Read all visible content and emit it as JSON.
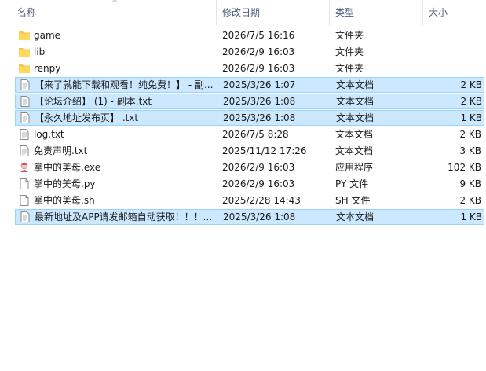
{
  "columns": {
    "name": "名称",
    "date": "修改日期",
    "type": "类型",
    "size": "大小"
  },
  "sort_indicator": "^",
  "files": [
    {
      "name": "game",
      "date": "2026/7/5 16:16",
      "type": "文件夹",
      "size": "",
      "icon": "folder-icon",
      "selected": false
    },
    {
      "name": "lib",
      "date": "2026/2/9 16:03",
      "type": "文件夹",
      "size": "",
      "icon": "folder-icon",
      "selected": false
    },
    {
      "name": "renpy",
      "date": "2026/2/9 16:03",
      "type": "文件夹",
      "size": "",
      "icon": "folder-icon",
      "selected": false
    },
    {
      "name": "【来了就能下载和观看！纯免费！】 - 副...",
      "date": "2025/3/26 1:07",
      "type": "文本文档",
      "size": "2 KB",
      "icon": "text-file-icon",
      "selected": true
    },
    {
      "name": "【论坛介绍】 (1) - 副本.txt",
      "date": "2025/3/26 1:08",
      "type": "文本文档",
      "size": "2 KB",
      "icon": "text-file-icon",
      "selected": true
    },
    {
      "name": "【永久地址发布页】 .txt",
      "date": "2025/3/26 1:08",
      "type": "文本文档",
      "size": "1 KB",
      "icon": "text-file-icon",
      "selected": true
    },
    {
      "name": "log.txt",
      "date": "2026/7/5 8:28",
      "type": "文本文档",
      "size": "2 KB",
      "icon": "text-file-icon",
      "selected": false
    },
    {
      "name": "免责声明.txt",
      "date": "2025/11/12 17:26",
      "type": "文本文档",
      "size": "3 KB",
      "icon": "text-file-icon",
      "selected": false
    },
    {
      "name": "掌中的美母.exe",
      "date": "2026/2/9 16:03",
      "type": "应用程序",
      "size": "102 KB",
      "icon": "app-icon",
      "selected": false
    },
    {
      "name": "掌中的美母.py",
      "date": "2026/2/9 16:03",
      "type": "PY 文件",
      "size": "9 KB",
      "icon": "blank-file-icon",
      "selected": false
    },
    {
      "name": "掌中的美母.sh",
      "date": "2025/2/28 14:43",
      "type": "SH 文件",
      "size": "2 KB",
      "icon": "blank-file-icon",
      "selected": false
    },
    {
      "name": "最新地址及APP请发邮箱自动获取！！！...",
      "date": "2025/3/26 1:08",
      "type": "文本文档",
      "size": "1 KB",
      "icon": "text-file-icon",
      "selected": true
    }
  ]
}
